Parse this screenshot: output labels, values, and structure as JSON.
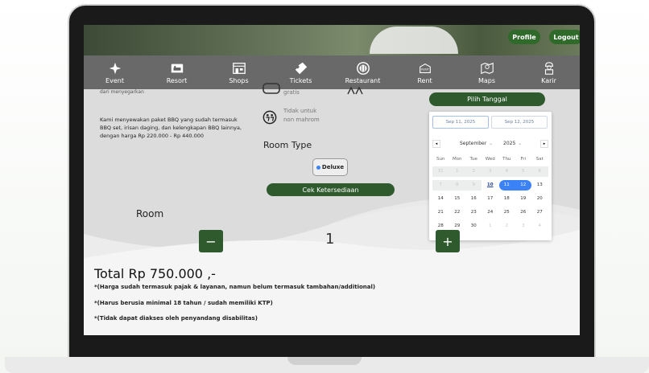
{
  "header": {
    "profile_label": "Profile",
    "logout_label": "Logout"
  },
  "nav": {
    "items": [
      {
        "label": "Event",
        "icon": "sparkle-icon"
      },
      {
        "label": "Resort",
        "icon": "bed-icon"
      },
      {
        "label": "Shops",
        "icon": "shop-icon"
      },
      {
        "label": "Tickets",
        "icon": "ticket-icon"
      },
      {
        "label": "Restaurant",
        "icon": "plate-icon"
      },
      {
        "label": "Rent",
        "icon": "rent-icon"
      },
      {
        "label": "Maps",
        "icon": "map-icon"
      },
      {
        "label": "Karir",
        "icon": "worker-icon"
      }
    ]
  },
  "content": {
    "partial_text": "dari menyegarkan",
    "bbq_description": "Kami menyewakan paket BBQ yang sudah termasuk BBQ set, irisan daging, dan kelengkapan BBQ lainnya, dengan harga Rp 220.000 - Rp 440.000",
    "free_label": "gratis",
    "no_mahrom_label": "Tidak untuk non mahrom",
    "room_type_title": "Room Type",
    "room_type_option": "Deluxe",
    "check_availability_label": "Cek Ketersediaan",
    "room_label": "Room",
    "minus_label": "−",
    "plus_label": "+",
    "room_count": "1",
    "total_label": "Total Rp 750.000 ,-",
    "note_1": "*(Harga sudah termasuk pajak & layanan, namun belum termasuk tambahan/additional)",
    "note_2": "*(Harus berusia minimal 18 tahun / sudah memiliki KTP)",
    "note_3": "*(Tidak dapat diakses oleh penyandang disabilitas)"
  },
  "calendar": {
    "pick_date_label": "Pilih Tanggal",
    "start_date": "Sep 11, 2025",
    "end_date": "Sep 12, 2025",
    "month": "September",
    "year": "2025",
    "weekdays": [
      "Sun",
      "Mon",
      "Tue",
      "Wed",
      "Thu",
      "Fri",
      "Sat"
    ],
    "weeks": [
      [
        "31",
        "1",
        "2",
        "3",
        "4",
        "5",
        "6"
      ],
      [
        "7",
        "8",
        "9",
        "10",
        "11",
        "12",
        "13"
      ],
      [
        "14",
        "15",
        "16",
        "17",
        "18",
        "19",
        "20"
      ],
      [
        "21",
        "22",
        "23",
        "24",
        "25",
        "26",
        "27"
      ],
      [
        "28",
        "29",
        "30",
        "1",
        "2",
        "3",
        "4"
      ]
    ],
    "accent": "#3b82f6"
  }
}
